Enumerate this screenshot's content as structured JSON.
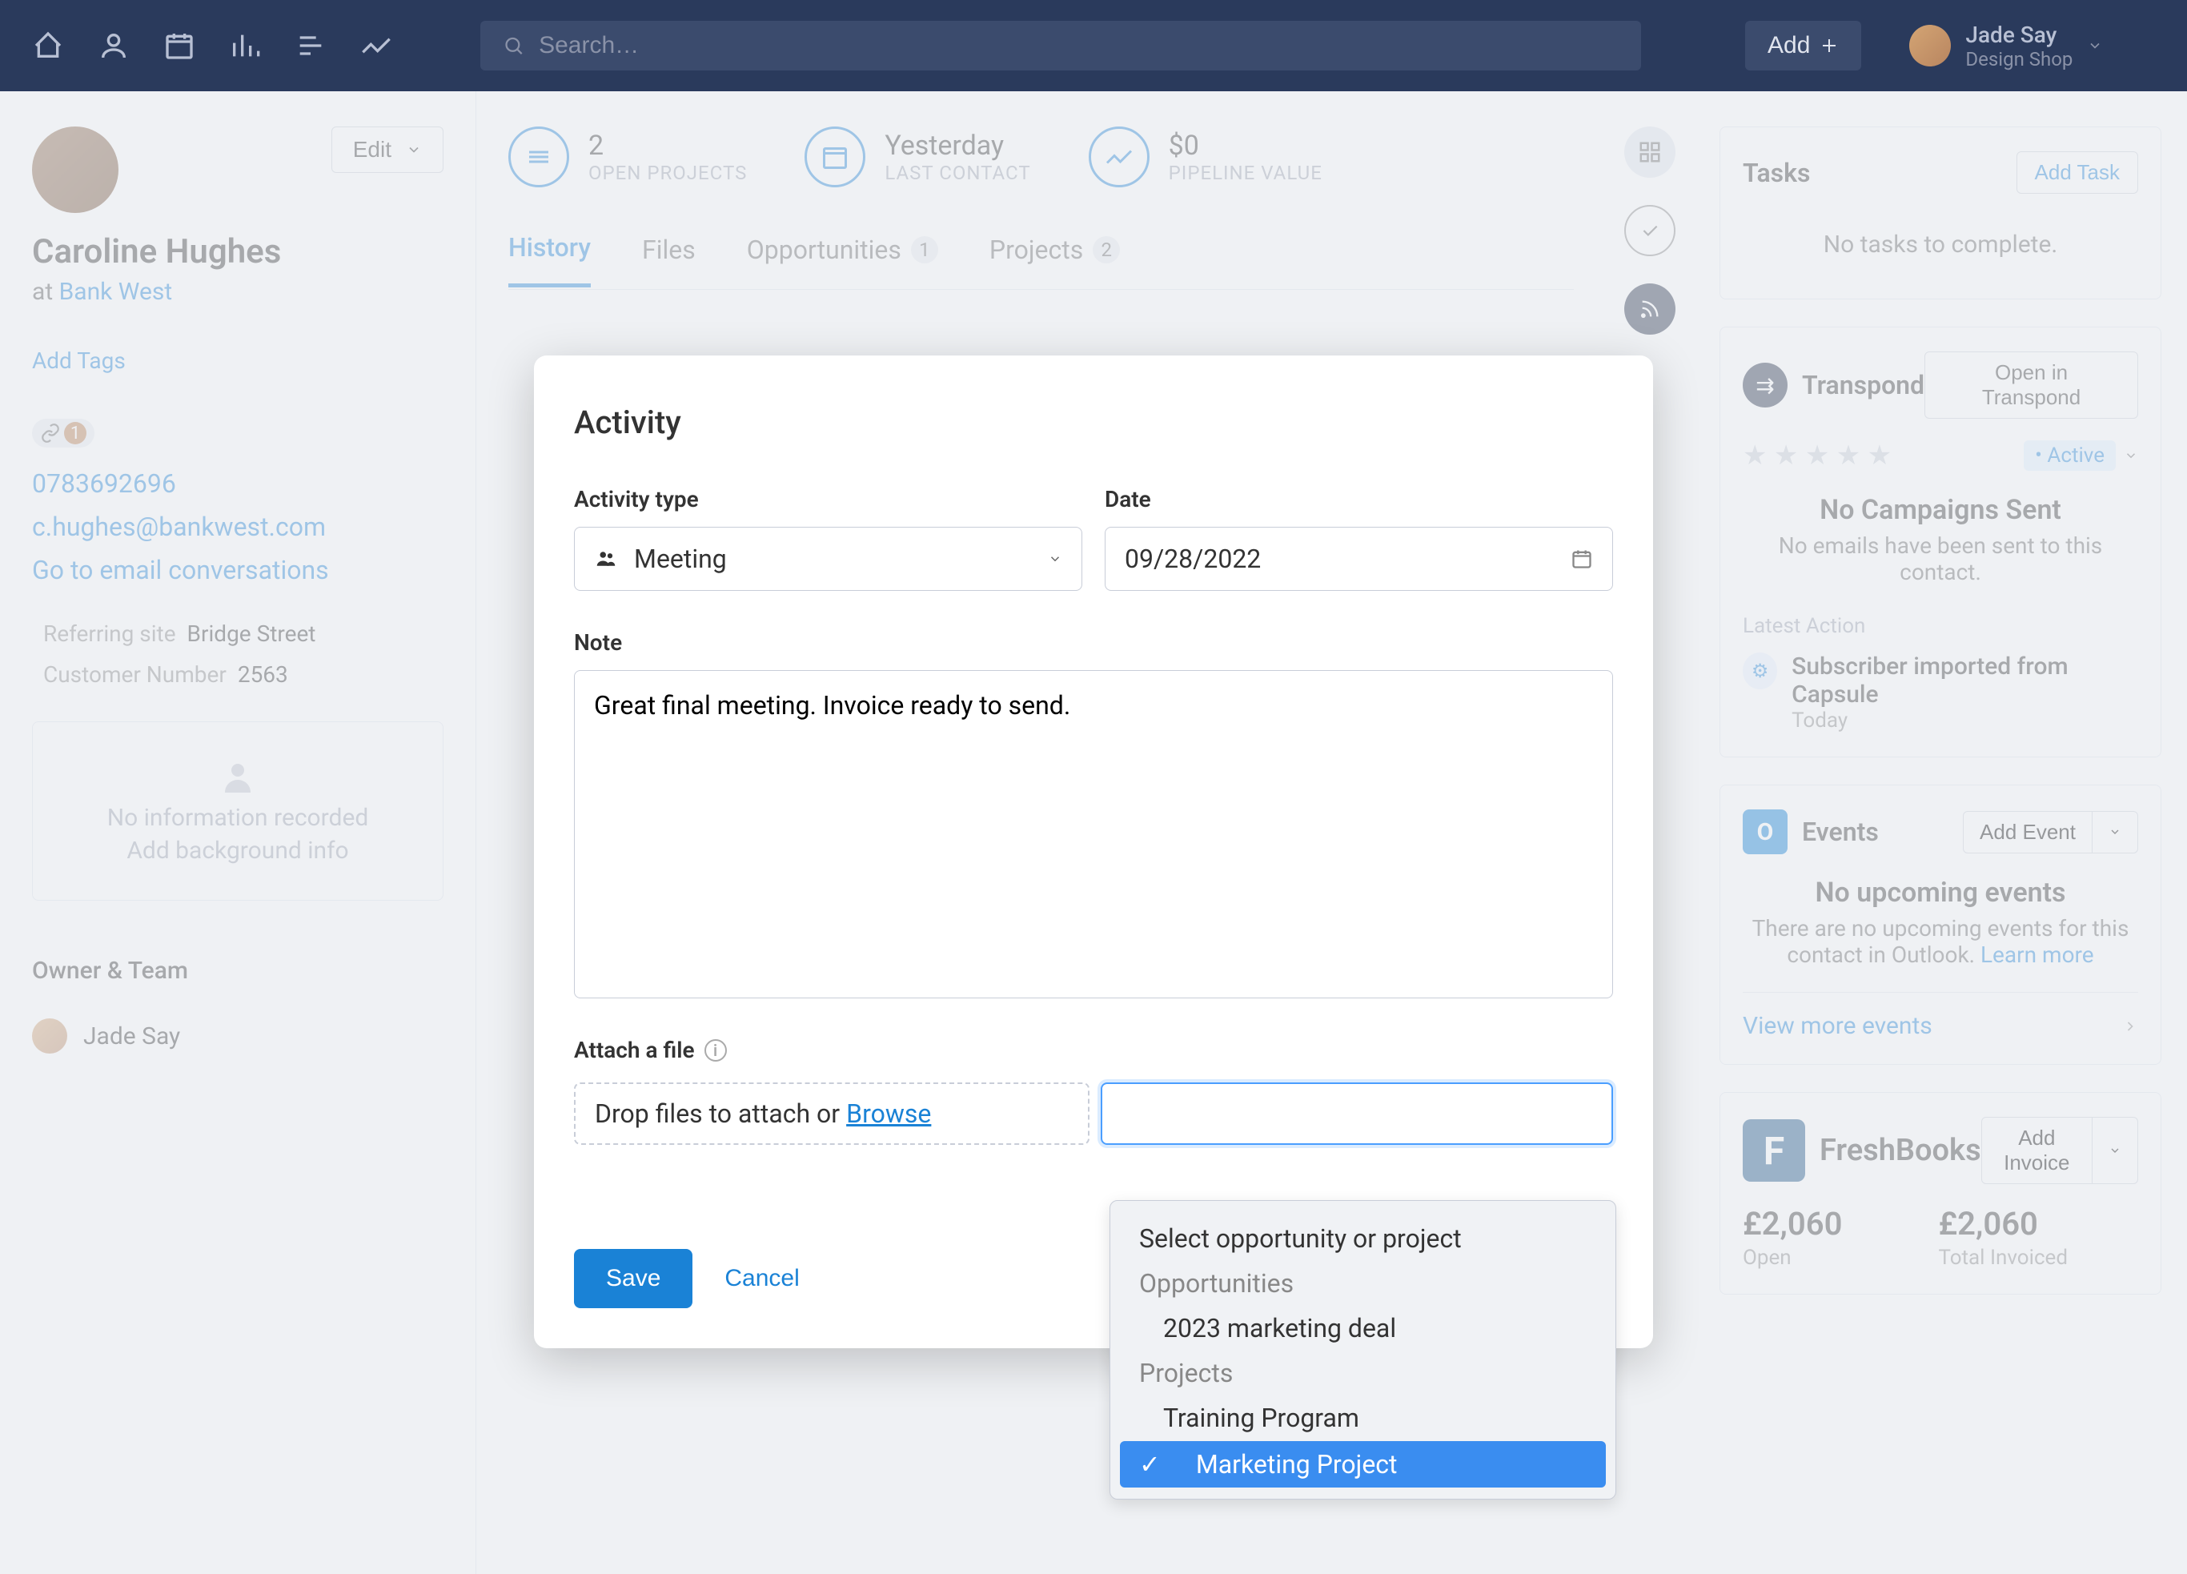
{
  "topbar": {
    "search_placeholder": "Search…",
    "add_label": "Add"
  },
  "user": {
    "name": "Jade Say",
    "subtitle": "Design Shop"
  },
  "contact": {
    "name": "Caroline Hughes",
    "at": "at ",
    "company": "Bank West",
    "add_tags": "Add Tags",
    "link_count": "1",
    "phone": "0783692696",
    "email": "c.hughes@bankwest.com",
    "email_convo": "Go to email conversations",
    "referring_label": "Referring site",
    "referring_value": "Bridge Street",
    "customer_num_label": "Customer Number",
    "customer_num_value": "2563",
    "no_info": "No information recorded",
    "add_bg": "Add background info",
    "owner_section": "Owner & Team",
    "owner_name": "Jade Say",
    "edit_label": "Edit"
  },
  "stats": {
    "open_projects_val": "2",
    "open_projects_label": "OPEN PROJECTS",
    "last_contact_val": "Yesterday",
    "last_contact_label": "LAST CONTACT",
    "pipeline_val": "$0",
    "pipeline_label": "PIPELINE VALUE"
  },
  "tabs": {
    "history": "History",
    "files": "Files",
    "opportunities": "Opportunities",
    "opportunities_count": "1",
    "projects": "Projects",
    "projects_count": "2"
  },
  "modal": {
    "title": "Activity",
    "activity_type_label": "Activity type",
    "activity_type_value": "Meeting",
    "date_label": "Date",
    "date_value": "09/28/2022",
    "note_label": "Note",
    "note_value": "Great final meeting. Invoice ready to send.",
    "attach_label": "Attach a file",
    "drop_text": "Drop files to attach or ",
    "browse": "Browse",
    "save": "Save",
    "cancel": "Cancel"
  },
  "dropdown": {
    "placeholder": "Select opportunity or project",
    "opportunities_header": "Opportunities",
    "opportunity_1": "2023 marketing deal",
    "projects_header": "Projects",
    "project_1": "Training Program",
    "project_2": "Marketing Project"
  },
  "panels": {
    "tasks_title": "Tasks",
    "add_task": "Add Task",
    "no_tasks": "No tasks to complete.",
    "transpond_title": "Transpond",
    "open_transpond": "Open in Transpond",
    "active_chip": "• Active",
    "no_campaigns": "No Campaigns Sent",
    "no_emails": "No emails have been sent to this contact.",
    "latest_action": "Latest Action",
    "latest_text": "Subscriber imported from Capsule",
    "latest_sub": "Today",
    "events_title": "Events",
    "add_event": "Add Event",
    "no_events_title": "No upcoming events",
    "no_events_sub": "There are no upcoming events for this contact in Outlook. ",
    "learn_more": "Learn more",
    "view_more": "View more events",
    "freshbooks_title": "FreshBooks",
    "add_invoice": "Add Invoice",
    "open_val": "£2,060",
    "open_lbl": "Open",
    "total_val": "£2,060",
    "total_lbl": "Total Invoiced"
  }
}
